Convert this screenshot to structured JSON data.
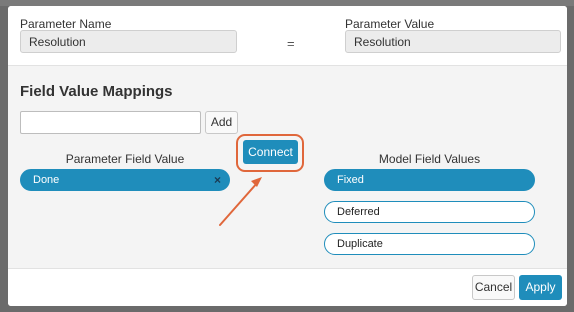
{
  "parameter": {
    "name_label": "Parameter Name",
    "name_value": "Resolution",
    "equals": "=",
    "value_label": "Parameter Value",
    "value_value": "Resolution"
  },
  "mappings": {
    "title": "Field Value Mappings",
    "input_value": "",
    "add_label": "Add",
    "connect_label": "Connect",
    "parameter_header": "Parameter Field Value",
    "model_header": "Model Field Values",
    "parameter_values": [
      {
        "label": "Done",
        "remove": "×",
        "selected": true
      }
    ],
    "model_values": [
      {
        "label": "Fixed",
        "selected": true
      },
      {
        "label": "Deferred",
        "selected": false
      },
      {
        "label": "Duplicate",
        "selected": false
      }
    ]
  },
  "footer": {
    "cancel_label": "Cancel",
    "apply_label": "Apply"
  },
  "colors": {
    "accent": "#1f8dbb",
    "highlight": "#e0673b"
  }
}
